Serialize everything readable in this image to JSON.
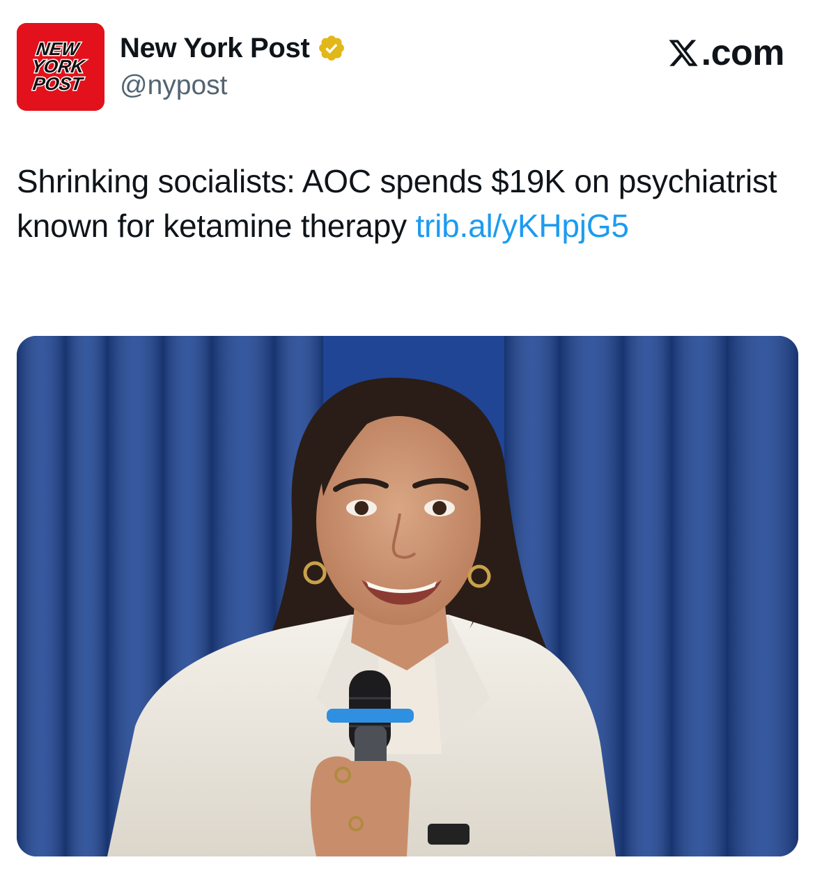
{
  "account": {
    "avatar_logo_lines": [
      "NEW",
      "YORK",
      "POST"
    ],
    "display_name": "New York Post",
    "handle": "@nypost",
    "verified_badge_color": "#e2b719",
    "avatar_bg_color": "#e3111b"
  },
  "source": {
    "label": ".com",
    "logo_icon": "x-logo-icon"
  },
  "tweet": {
    "text": "Shrinking socialists: AOC spends $19K on psychiatrist known for ketamine therapy ",
    "link": "trib.al/yKHpjG5",
    "link_color": "#1d9bf0"
  },
  "media": {
    "kind": "photo",
    "subject": "woman-with-microphone",
    "background_color": "#1f4594"
  }
}
